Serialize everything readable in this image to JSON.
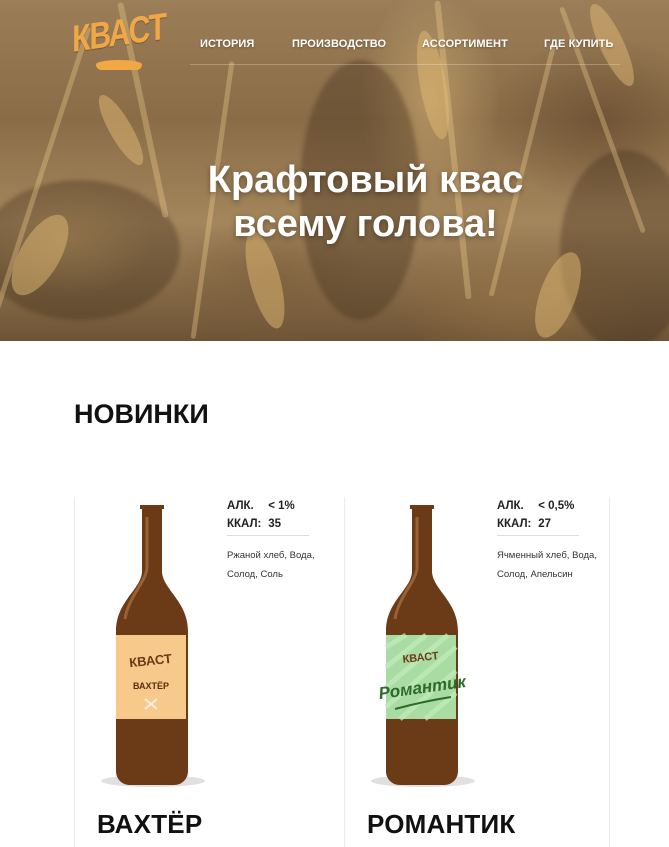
{
  "header": {
    "logo_text": "КВАСТ",
    "nav": [
      "ИСТОРИЯ",
      "ПРОИЗВОДСТВО",
      "АССОРТИМЕНТ",
      "ГДЕ КУПИТЬ"
    ]
  },
  "hero": {
    "title_line1": "Крафтовый квас",
    "title_line2": "всему голова!"
  },
  "section": {
    "title": "НОВИНКИ"
  },
  "products": [
    {
      "name": "ВАХТЁР",
      "alc_label": "АЛК.",
      "alc_value": "< 1%",
      "kcal_label": "ККАЛ:",
      "kcal_value": "35",
      "ingredients": "Ржаной хлеб, Вода, Солод, Соль",
      "label_brand": "КВАСТ",
      "label_name": "ВАХТЁР",
      "label_color": "#f7c98a"
    },
    {
      "name": "РОМАНТИК",
      "alc_label": "АЛК.",
      "alc_value": "< 0,5%",
      "kcal_label": "ККАЛ:",
      "kcal_value": "27",
      "ingredients": "Ячменный хлеб, Вода, Солод, Апельсин",
      "label_brand": "КВАСТ",
      "label_name": "Романтик",
      "label_color": "#a8dca2"
    }
  ],
  "colors": {
    "accent": "#f0a846",
    "bottle": "#6b3a16"
  }
}
